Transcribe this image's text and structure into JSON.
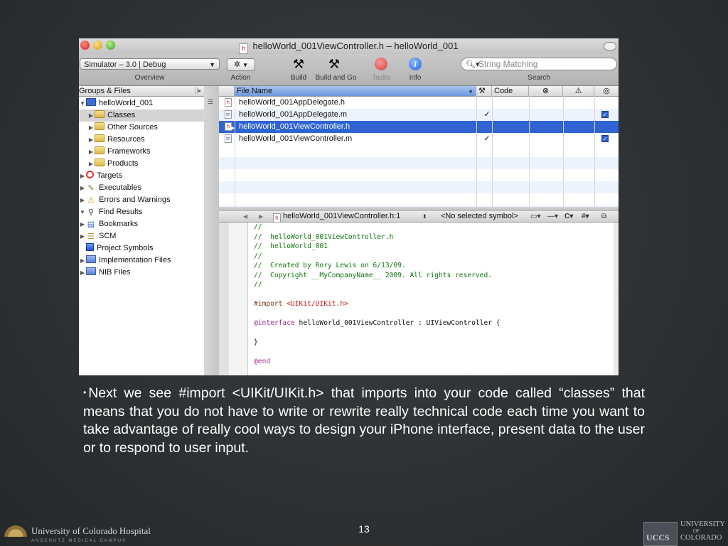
{
  "window": {
    "title": "helloWorld_001ViewController.h – helloWorld_001",
    "title_badge": "h"
  },
  "toolbar": {
    "scheme_value": "Simulator – 3.0 | Debug",
    "overview_label": "Overview",
    "action_label": "Action",
    "build_label": "Build",
    "build_go_label": "Build and Go",
    "tasks_label": "Tasks",
    "info_label": "Info",
    "search_placeholder": "String Matching",
    "search_label": "Search"
  },
  "sidebar": {
    "header": "Groups & Files",
    "items": [
      {
        "label": "helloWorld_001",
        "icon": "project-icon"
      },
      {
        "label": "Classes",
        "icon": "folder-icon"
      },
      {
        "label": "Other Sources",
        "icon": "folder-icon"
      },
      {
        "label": "Resources",
        "icon": "folder-icon"
      },
      {
        "label": "Frameworks",
        "icon": "folder-icon"
      },
      {
        "label": "Products",
        "icon": "folder-icon"
      },
      {
        "label": "Targets",
        "icon": "target-icon"
      },
      {
        "label": "Executables",
        "icon": "executables-icon"
      },
      {
        "label": "Errors and Warnings",
        "icon": "warning-icon"
      },
      {
        "label": "Find Results",
        "icon": "magnifier-icon"
      },
      {
        "label": "Bookmarks",
        "icon": "bookmarks-icon"
      },
      {
        "label": "SCM",
        "icon": "scm-icon"
      },
      {
        "label": "Project Symbols",
        "icon": "cube-icon"
      },
      {
        "label": "Implementation Files",
        "icon": "smart-folder-icon"
      },
      {
        "label": "NIB Files",
        "icon": "smart-folder-icon"
      }
    ]
  },
  "filelist": {
    "columns": {
      "name": "File Name",
      "code": "Code"
    },
    "rows": [
      {
        "name": "helloWorld_001AppDelegate.h",
        "type": "h",
        "check": "",
        "target": false
      },
      {
        "name": "helloWorld_001AppDelegate.m",
        "type": "m",
        "check": "✓",
        "target": true
      },
      {
        "name": "helloWorld_001ViewController.h",
        "type": "h",
        "check": "",
        "target": false
      },
      {
        "name": "helloWorld_001ViewController.m",
        "type": "m",
        "check": "✓",
        "target": true
      }
    ]
  },
  "editor": {
    "file_popup": "helloWorld_001ViewController.h:1",
    "symbol_popup": "<No selected symbol>",
    "code": [
      {
        "cls": "c-com",
        "text": "//"
      },
      {
        "cls": "c-com",
        "text": "//  helloWorld_001ViewController.h"
      },
      {
        "cls": "c-com",
        "text": "//  helloWorld_001"
      },
      {
        "cls": "c-com",
        "text": "//"
      },
      {
        "cls": "c-com",
        "text": "//  Created by Rory Lewis on 6/13/09."
      },
      {
        "cls": "c-com",
        "text": "//  Copyright __MyCompanyName__ 2009. All rights reserved."
      },
      {
        "cls": "c-com",
        "text": "//"
      },
      {
        "cls": "c-txt",
        "text": ""
      },
      {
        "cls": "c-pre",
        "text": "#import ",
        "extra": "<UIKit/UIKit.h>"
      },
      {
        "cls": "c-txt",
        "text": ""
      },
      {
        "cls": "c-kw",
        "text": "@interface",
        "extra": " helloWorld_001ViewController : UIViewController {"
      },
      {
        "cls": "c-txt",
        "text": ""
      },
      {
        "cls": "c-txt",
        "text": "}"
      },
      {
        "cls": "c-txt",
        "text": ""
      },
      {
        "cls": "c-kw",
        "text": "@end"
      }
    ]
  },
  "slide": {
    "bullet": "•",
    "body": "Next we see #import <UIKit/UIKit.h> that imports into your code called “classes” that means that you do not have to write or rewrite really technical code each time you want to take advantage of really cool ways to design your iPhone interface, present data to the user or to respond to user input.",
    "page_number": "13",
    "footer_left": "University of Colorado Hospital",
    "footer_left_sub": "ANSCHUTZ MEDICAL CAMPUS",
    "footer_right_box": "UCCS",
    "footer_right_1": "UNIVERSITY",
    "footer_right_of": "OF",
    "footer_right_2": "COLORADO"
  },
  "colors": {
    "selection": "#2f64d2",
    "comment": "#117711",
    "keyword": "#a0278f",
    "string": "#c41a16"
  }
}
